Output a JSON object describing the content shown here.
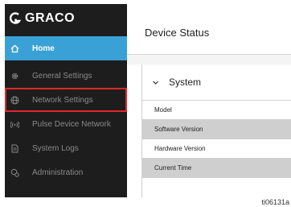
{
  "brand": {
    "logo_text": "GRACO"
  },
  "sidebar": {
    "items": [
      {
        "label": "Home",
        "icon": "home-icon",
        "active": true
      },
      {
        "label": "General Settings",
        "icon": "gear-icon"
      },
      {
        "label": "Network Settings",
        "icon": "globe-icon",
        "highlighted": true
      },
      {
        "label": "Pulse Device Network",
        "icon": "wireless-icon"
      },
      {
        "label": "System Logs",
        "icon": "document-icon"
      },
      {
        "label": "Administration",
        "icon": "admin-icon"
      }
    ]
  },
  "main": {
    "title": "Device Status",
    "section": {
      "title": "System",
      "rows": [
        "Model",
        "Software Version",
        "Hardware Version",
        "Current Time"
      ]
    }
  },
  "figure_id": "ti06131a",
  "colors": {
    "sidebar_bg": "#1d1d1d",
    "active_item": "#3aa1d6",
    "highlight_box": "#e3262b",
    "row_shade": "#cfcfcf"
  }
}
